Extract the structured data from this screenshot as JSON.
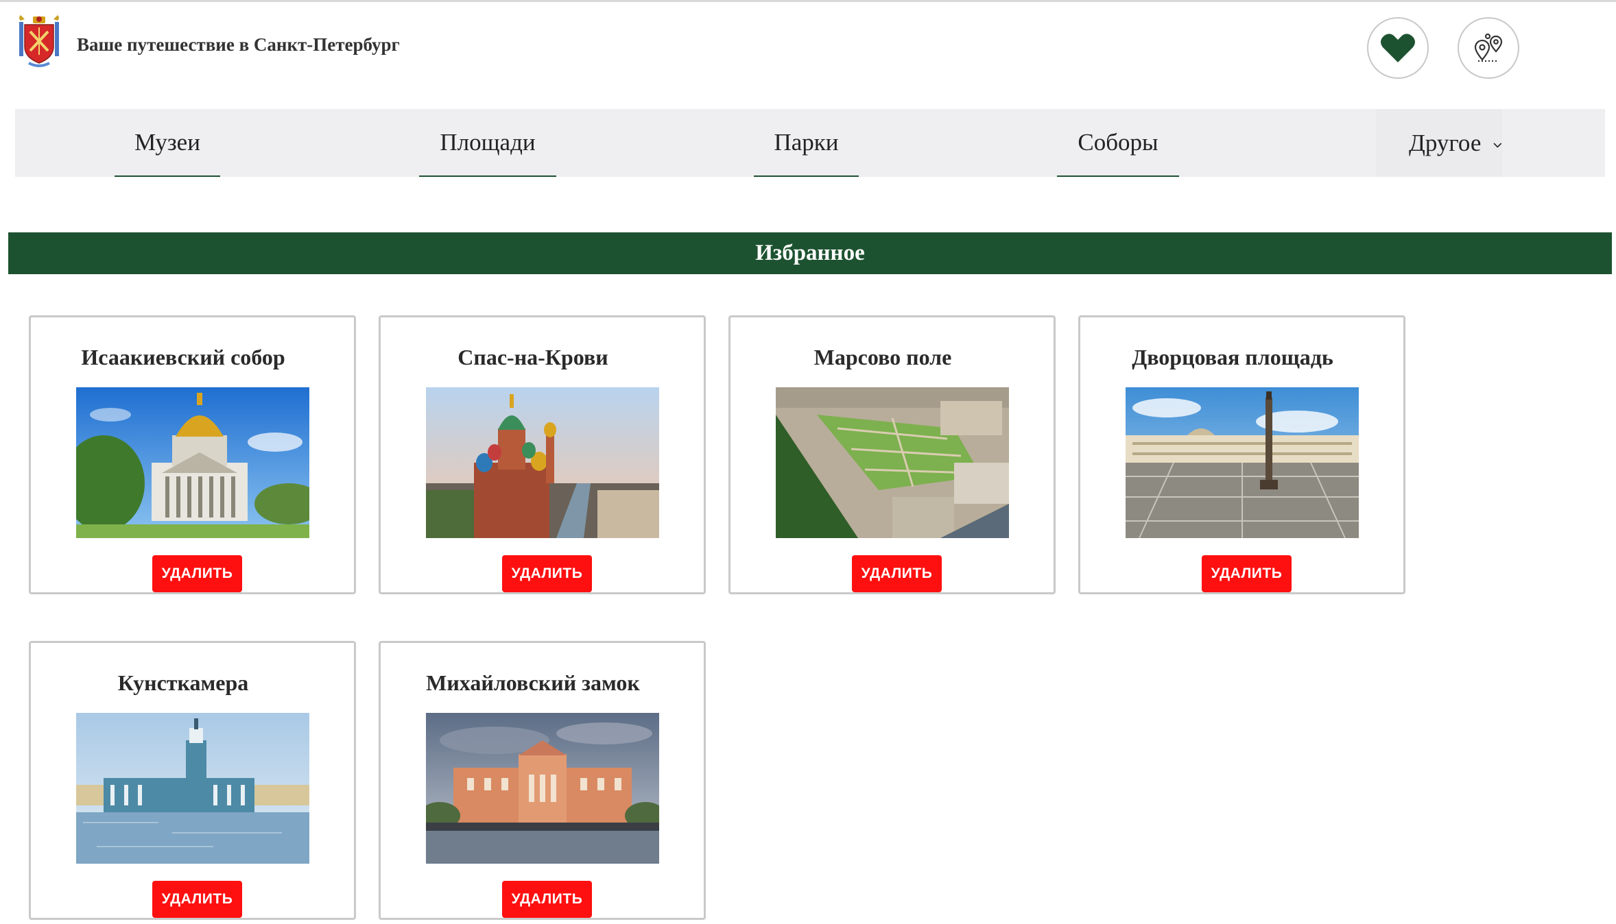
{
  "header": {
    "title": "Ваше путешествие в Санкт-Петербург",
    "logo_icon": "spb-coat-of-arms-icon",
    "favorites_icon": "heart-icon",
    "route_icon": "map-pins-icon"
  },
  "nav": {
    "items": [
      {
        "label": "Музеи"
      },
      {
        "label": "Площади"
      },
      {
        "label": "Парки"
      },
      {
        "label": "Соборы"
      }
    ],
    "other_label": "Другое",
    "other_icon": "chevron-down-icon"
  },
  "section": {
    "title": "Избранное"
  },
  "cards": [
    {
      "title": "Исаакиевский собор",
      "delete_label": "УДАЛИТЬ"
    },
    {
      "title": "Спас-на-Крови",
      "delete_label": "УДАЛИТЬ"
    },
    {
      "title": "Марсово поле",
      "delete_label": "УДАЛИТЬ"
    },
    {
      "title": "Дворцовая площадь",
      "delete_label": "УДАЛИТЬ"
    },
    {
      "title": "Кунсткамера",
      "delete_label": "УДАЛИТЬ"
    },
    {
      "title": "Михайловский замок",
      "delete_label": "УДАЛИТЬ"
    }
  ],
  "colors": {
    "brand_green": "#1d5230",
    "delete_red": "#ff1010",
    "nav_bg": "#efeff1"
  }
}
